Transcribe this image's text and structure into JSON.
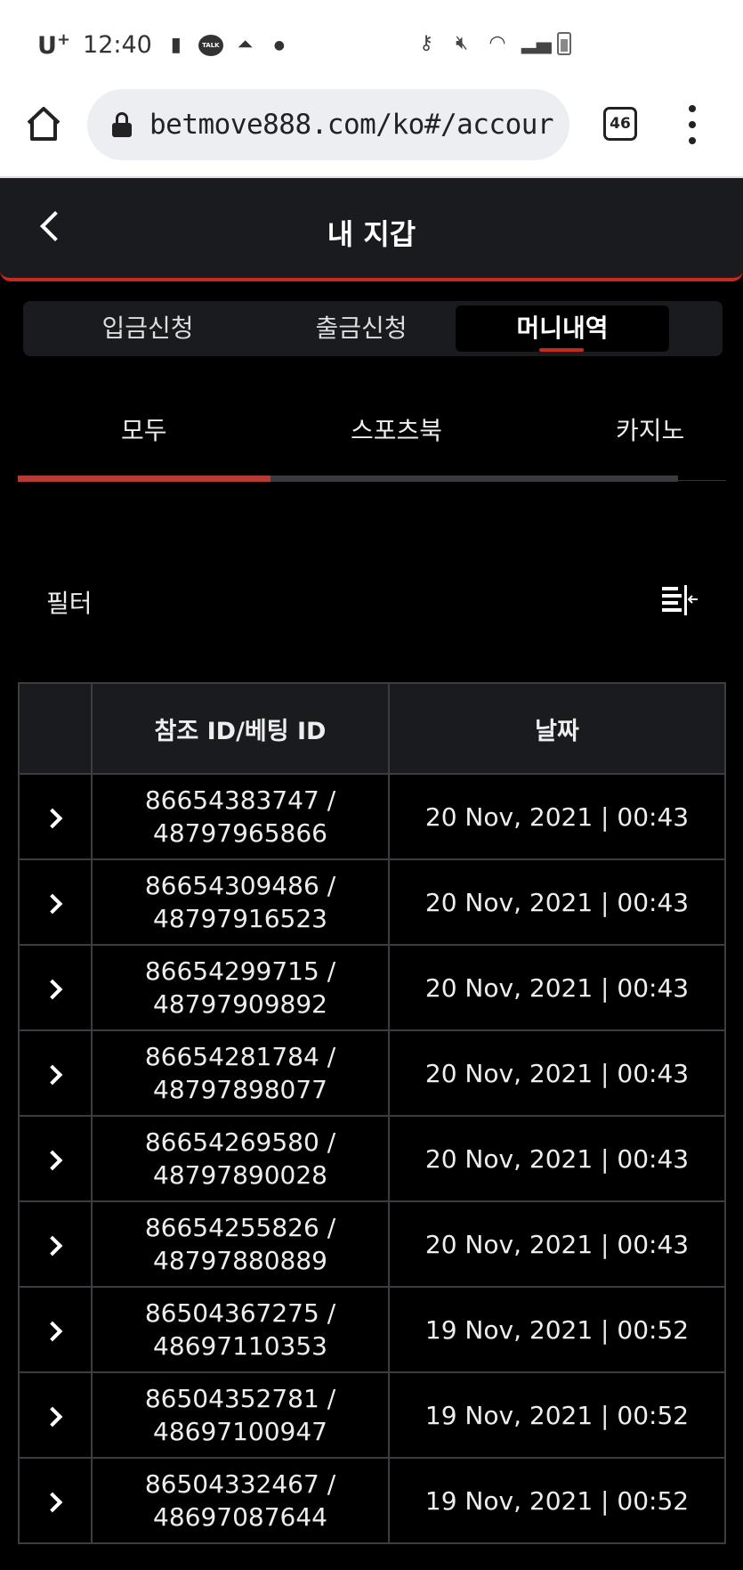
{
  "status_bar": {
    "carrier": "U",
    "carrier_sup": "+",
    "time": "12:40",
    "talk_badge": "TALK"
  },
  "browser": {
    "url": "betmove888.com/ko#/accour",
    "tab_count": "46"
  },
  "header": {
    "title": "내 지갑"
  },
  "main_tabs": [
    {
      "label": "입금신청"
    },
    {
      "label": "출금신청"
    },
    {
      "label": "머니내역"
    }
  ],
  "sub_tabs": [
    {
      "label": "모두"
    },
    {
      "label": "스포츠북"
    },
    {
      "label": "카지노"
    }
  ],
  "filter": {
    "label": "필터"
  },
  "table": {
    "headers": {
      "ref_id": "참조 ID/베팅 ID",
      "date": "날짜"
    },
    "rows": [
      {
        "ref": "86654383747 /",
        "bet": "48797965866",
        "date": "20 Nov, 2021 | 00:43"
      },
      {
        "ref": "86654309486 /",
        "bet": "48797916523",
        "date": "20 Nov, 2021 | 00:43"
      },
      {
        "ref": "86654299715 /",
        "bet": "48797909892",
        "date": "20 Nov, 2021 | 00:43"
      },
      {
        "ref": "86654281784 /",
        "bet": "48797898077",
        "date": "20 Nov, 2021 | 00:43"
      },
      {
        "ref": "86654269580 /",
        "bet": "48797890028",
        "date": "20 Nov, 2021 | 00:43"
      },
      {
        "ref": "86654255826 /",
        "bet": "48797880889",
        "date": "20 Nov, 2021 | 00:43"
      },
      {
        "ref": "86504367275 /",
        "bet": "48697110353",
        "date": "19 Nov, 2021 | 00:52"
      },
      {
        "ref": "86504352781 /",
        "bet": "48697100947",
        "date": "19 Nov, 2021 | 00:52"
      },
      {
        "ref": "86504332467 /",
        "bet": "48697087644",
        "date": "19 Nov, 2021 | 00:52"
      }
    ]
  }
}
